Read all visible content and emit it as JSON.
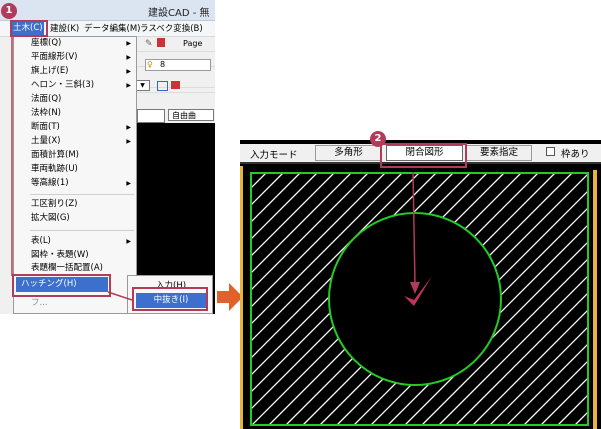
{
  "app": {
    "title": "建設CAD - 無"
  },
  "menubar": {
    "items": [
      "土木(C)",
      "建設(K)",
      "データ編集(M)",
      "ラスベク変換(B)"
    ]
  },
  "toolbar": {
    "page_label": "Page",
    "layer_value": "8",
    "button_label": "自由曲"
  },
  "dropdown": {
    "items": [
      {
        "label": "座標(Q)",
        "submenu": true
      },
      {
        "label": "平面線形(V)",
        "submenu": true
      },
      {
        "label": "旗上げ(E)",
        "submenu": true
      },
      {
        "label": "ヘロン・三斜(3)",
        "submenu": true
      },
      {
        "label": "法面(Q)",
        "submenu": false
      },
      {
        "label": "法枠(N)",
        "submenu": false
      },
      {
        "label": "断面(T)",
        "submenu": true
      },
      {
        "label": "土量(X)",
        "submenu": true
      },
      {
        "label": "面積計算(M)",
        "submenu": false
      },
      {
        "label": "車両軌跡(U)",
        "submenu": false
      },
      {
        "label": "等高線(1)",
        "submenu": true
      },
      {
        "label": "工区割り(Z)",
        "submenu": false
      },
      {
        "label": "拡大図(G)",
        "submenu": false
      },
      {
        "label": "表(L)",
        "submenu": true
      },
      {
        "label": "図枠・表題(W)",
        "submenu": false
      },
      {
        "label": "表題欄一括配置(A)",
        "submenu": false
      }
    ],
    "hatching": "ハッチング(H)",
    "below": "フ..."
  },
  "submenu": {
    "input": "入力(H)",
    "nukidashi": "中抜き(I)"
  },
  "badges": {
    "one": "1",
    "two": "2"
  },
  "right_panel": {
    "mode_label": "入力モード",
    "segments": {
      "polygon": "多角形",
      "closed": "閉合図形",
      "element": "要素指定"
    },
    "frame_checkbox": "枠あり"
  },
  "colors": {
    "highlight": "#b23a5a",
    "arrow": "#e0622a",
    "menu_select": "#3d6fcf",
    "circle": "#22cc22"
  }
}
